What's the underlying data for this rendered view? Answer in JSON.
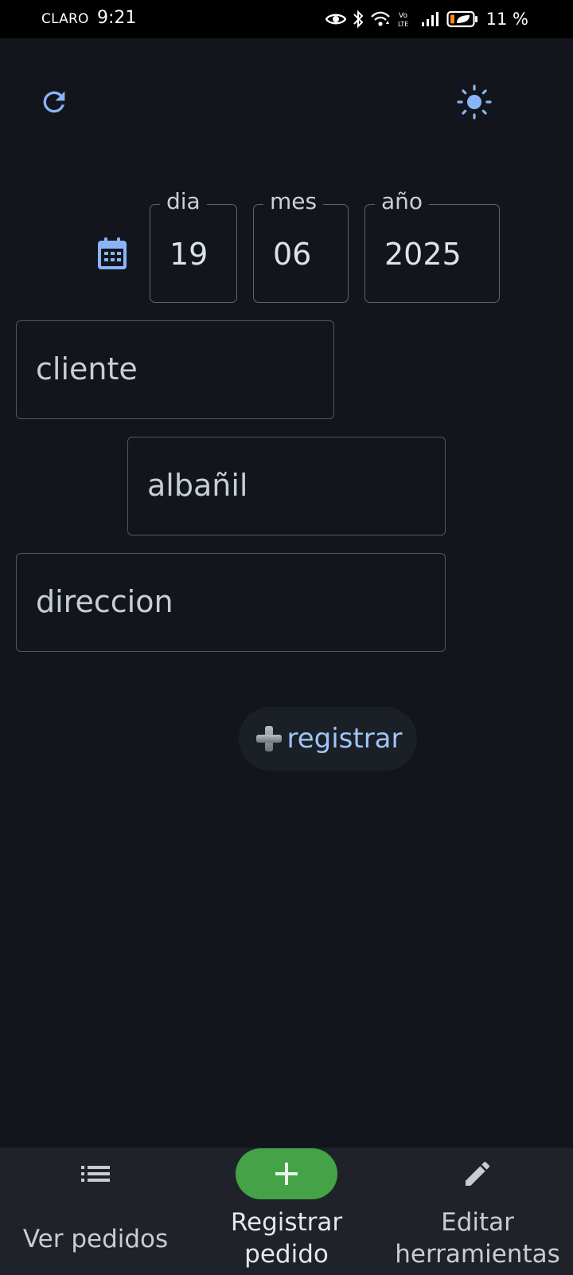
{
  "status_bar": {
    "carrier": "CLARO",
    "time": "9:21",
    "battery_percent": "11 %"
  },
  "top_bar": {
    "refresh_icon": "refresh-icon",
    "theme_icon": "sun-icon"
  },
  "date": {
    "icon": "calendar-icon",
    "day_label": "dia",
    "day_value": "19",
    "month_label": "mes",
    "month_value": "06",
    "year_label": "año",
    "year_value": "2025"
  },
  "form": {
    "cliente_placeholder": "cliente",
    "albanil_placeholder": "albañil",
    "direccion_placeholder": "direccion",
    "register_label": "registrar",
    "register_icon": "plus-emoji-icon"
  },
  "bottom_nav": {
    "items": [
      {
        "label_line1": "Ver pedidos",
        "label_line2": "",
        "icon": "list-icon",
        "active": false
      },
      {
        "label_line1": "Registrar",
        "label_line2": "pedido",
        "icon": "add-icon",
        "active": true
      },
      {
        "label_line1": "Editar",
        "label_line2": "herramientas",
        "icon": "edit-icon",
        "active": false
      }
    ]
  },
  "colors": {
    "background": "#12161c",
    "accent_blue": "#8ab4f8",
    "active_nav": "#43a346",
    "nav_bar": "#1f2329"
  }
}
